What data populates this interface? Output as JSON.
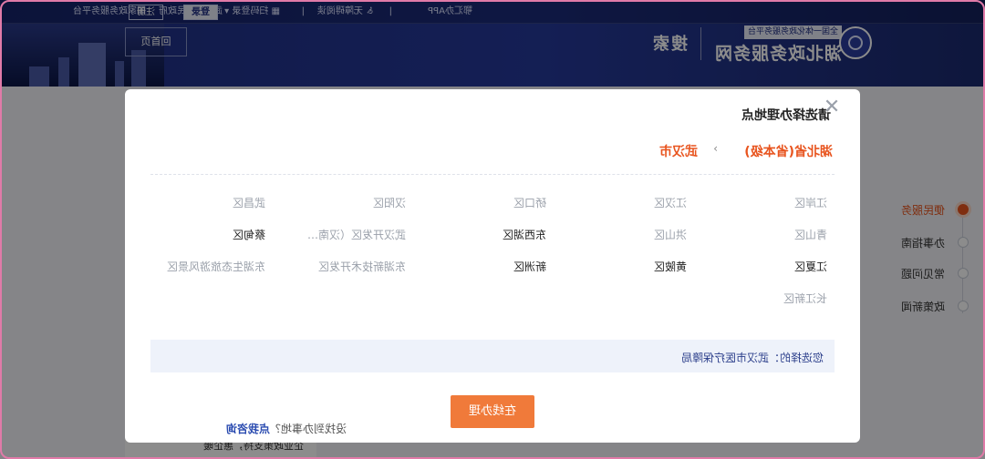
{
  "topbar": {
    "national_platform": "国家政务服务平台",
    "wuhan_gov": "武汉市人民政府",
    "register": "注册",
    "login": "登录",
    "scan_login": "扫码登录",
    "accessibility": "无障碍阅读",
    "app": "鄂汇办APP"
  },
  "header": {
    "brand_title": "湖北政务服务网",
    "brand_sub": "全国一体化政务服务平台",
    "search": "搜索",
    "home": "回首页"
  },
  "side_menu": {
    "items": [
      {
        "label": "便民服务",
        "active": true
      },
      {
        "label": "办事指南",
        "active": false
      },
      {
        "label": "常见问题",
        "active": false
      },
      {
        "label": "政策新闻",
        "active": false
      }
    ]
  },
  "side_card": {
    "text": "企业政策支持，惠企暖"
  },
  "modal": {
    "title": "请选择办理地点",
    "close_symbol": "✕",
    "crumb_province": "湖北省(省本级)",
    "crumb_sep": "›",
    "crumb_city": "武汉市",
    "districts": [
      {
        "label": "江岸区",
        "enabled": false
      },
      {
        "label": "江汉区",
        "enabled": false
      },
      {
        "label": "硚口区",
        "enabled": false
      },
      {
        "label": "汉阳区",
        "enabled": false
      },
      {
        "label": "武昌区",
        "enabled": false
      },
      {
        "label": "青山区",
        "enabled": false
      },
      {
        "label": "洪山区",
        "enabled": false
      },
      {
        "label": "东西湖区",
        "enabled": true
      },
      {
        "label": "武汉开发区（汉南…",
        "enabled": false
      },
      {
        "label": "蔡甸区",
        "enabled": true
      },
      {
        "label": "江夏区",
        "enabled": true
      },
      {
        "label": "黄陂区",
        "enabled": true
      },
      {
        "label": "新洲区",
        "enabled": true
      },
      {
        "label": "东湖新技术开发区",
        "enabled": false
      },
      {
        "label": "东湖生态旅游风景区",
        "enabled": false
      },
      {
        "label": "长江新区",
        "enabled": false
      }
    ],
    "selected_label": "您选择的：武汉市医疗保障局",
    "online_button": "在线办理",
    "footer_question": "没找到办事地？",
    "footer_link": "点我咨询"
  }
}
